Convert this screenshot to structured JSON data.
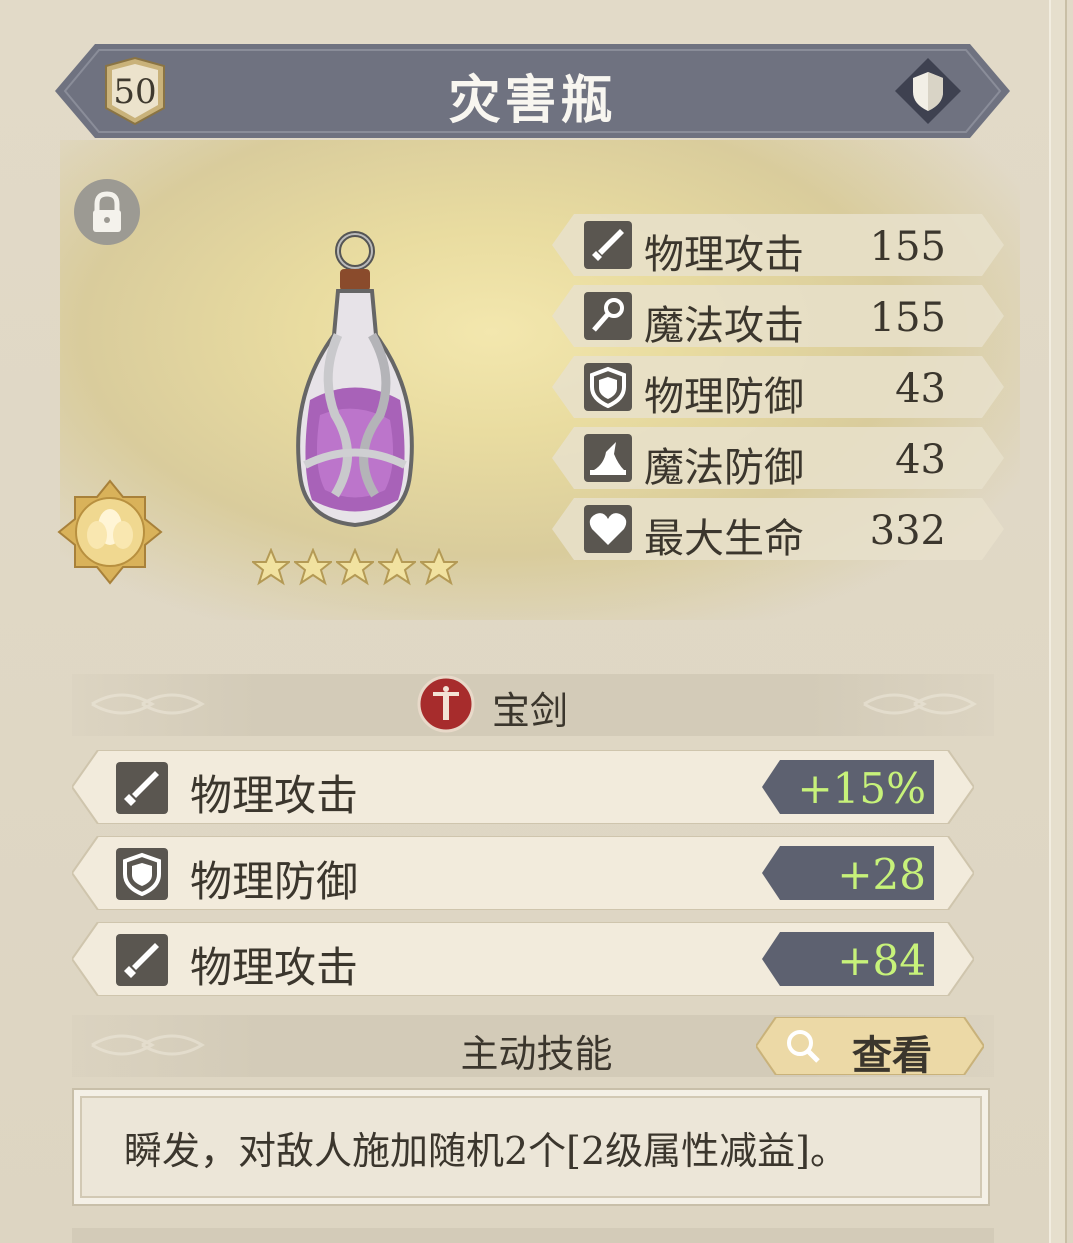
{
  "item": {
    "level": "50",
    "name": "灾害瓶",
    "star_count": 5
  },
  "stats": [
    {
      "icon": "sword-icon",
      "label": "物理攻击",
      "value": "155"
    },
    {
      "icon": "staff-icon",
      "label": "魔法攻击",
      "value": "155"
    },
    {
      "icon": "shield-icon",
      "label": "物理防御",
      "value": "43"
    },
    {
      "icon": "wizard-hat-icon",
      "label": "魔法防御",
      "value": "43"
    },
    {
      "icon": "heart-icon",
      "label": "最大生命",
      "value": "332"
    }
  ],
  "type_section": {
    "icon": "sword-emblem-icon",
    "label": "宝剑"
  },
  "sub_stats": [
    {
      "icon": "sword-icon",
      "label": "物理攻击",
      "value": "+15%"
    },
    {
      "icon": "shield-icon",
      "label": "物理防御",
      "value": "+28"
    },
    {
      "icon": "sword-icon",
      "label": "物理攻击",
      "value": "+84"
    }
  ],
  "skill": {
    "title": "主动技能",
    "view_label": "查看",
    "description": "瞬发，对敌人施加随机2个[2级属性减益]。"
  },
  "colors": {
    "title_bar": "#6f7280",
    "value_green": "#c7f27a",
    "value_pill": "#5d6170"
  }
}
